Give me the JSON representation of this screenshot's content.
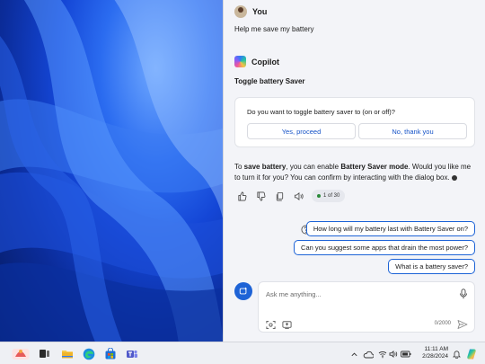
{
  "user": {
    "name": "You",
    "message": "Help me save my battery"
  },
  "copilot": {
    "name": "Copilot",
    "section_title": "Toggle battery Saver",
    "dialog": {
      "question": "Do you want to toggle battery saver to (on or off)?",
      "yes_label": "Yes, proceed",
      "no_label": "No, thank you"
    },
    "answer": {
      "p1": "To ",
      "b1": "save battery",
      "p2": ", you can enable ",
      "b2": "Battery Saver mode",
      "p3": ". Would you like me to turn it for you? You can confirm by interacting with the dialog box."
    },
    "page_indicator": "1 of 30"
  },
  "suggestions": [
    "How long will my battery last with Battery Saver on?",
    "Can you suggest some apps that drain the most power?",
    "What is a battery saver?"
  ],
  "composer": {
    "placeholder": "Ask me anything...",
    "counter": "0/2000"
  },
  "taskbar": {
    "time": "11:11 AM",
    "date": "2/28/2024",
    "pinned_icons": [
      "widget-icon",
      "task-view-icon",
      "file-explorer-icon",
      "edge-icon",
      "store-icon",
      "teams-icon"
    ]
  },
  "colors": {
    "accent": "#1e63d6",
    "pane_bg": "#f3f4f8"
  }
}
